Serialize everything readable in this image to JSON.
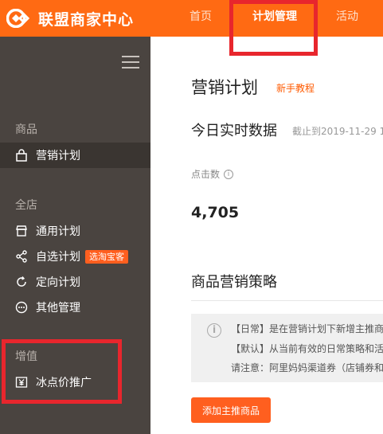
{
  "app": {
    "logo_text": "联盟商家中心"
  },
  "nav": {
    "home": "首页",
    "plan": "计划管理",
    "activity": "活动"
  },
  "sidebar": {
    "sections": [
      {
        "title": "商品",
        "items": [
          {
            "label": "营销计划",
            "icon": "bag-icon"
          }
        ]
      },
      {
        "title": "全店",
        "items": [
          {
            "label": "通用计划",
            "icon": "store-icon"
          },
          {
            "label": "自选计划",
            "icon": "share-icon",
            "tag": "选淘宝客"
          },
          {
            "label": "定向计划",
            "icon": "refresh-icon"
          },
          {
            "label": "其他管理",
            "icon": "more-icon"
          }
        ]
      },
      {
        "title": "增值",
        "items": [
          {
            "label": "冰点价推广",
            "icon": "yen-icon"
          }
        ]
      }
    ]
  },
  "main": {
    "page_title": "营销计划",
    "tutorial_link": "新手教程",
    "realtime_title": "今日实时数据",
    "cutoff_text": "截止到2019-11-29 1",
    "clicks_label": "点击数",
    "clicks_value": "4,705",
    "strategy_title": "商品营销策略",
    "notice": {
      "line1": "【日常】是在营销计划下新增主推商",
      "line2": "【默认】从当前有效的日常策略和活",
      "line3": "请注意：阿里妈妈渠道券（店铺券和"
    },
    "add_button": "添加主推商品"
  },
  "colors": {
    "brand": "#ff6a13",
    "sidebar_bg": "#4a4440",
    "highlight": "#e8262d",
    "button": "#ff5f1f"
  }
}
